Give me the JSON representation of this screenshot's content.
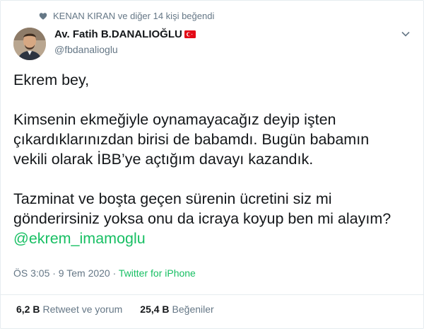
{
  "social_context": {
    "icon": "heart-icon",
    "text": "KENAN KIRAN ve diğer 14 kişi beğendi"
  },
  "author": {
    "name": "Av. Fatih B.DANALIOĞLU",
    "flag": "turkey-flag-icon",
    "handle": "@fbdanalioglu"
  },
  "tweet": {
    "line1": "Ekrem bey,",
    "line2": "Kimsenin ekmeğiyle oynamayacağız deyip işten",
    "line3": "çıkardıklarınızdan birisi de babamdı. Bugün babamın",
    "line4": "vekili olarak İBB’ye açtığım davayı kazandık.",
    "line5": "Tazminat ve boşta geçen sürenin ücretini siz mi",
    "line6": "gönderirsiniz yoksa onu da icraya koyup ben mi alayım?",
    "mention": "@ekrem_imamoglu"
  },
  "meta": {
    "time_date": "ÖS 3:05 · 9 Tem 2020 · ",
    "source": "Twitter for iPhone"
  },
  "stats": {
    "retweets_count": "6,2 B",
    "retweets_label": "Retweet ve yorum",
    "likes_count": "25,4 B",
    "likes_label": "Beğeniler"
  },
  "colors": {
    "accent": "#17bf63",
    "secondary_text": "#657786",
    "primary_text": "#14171a"
  }
}
